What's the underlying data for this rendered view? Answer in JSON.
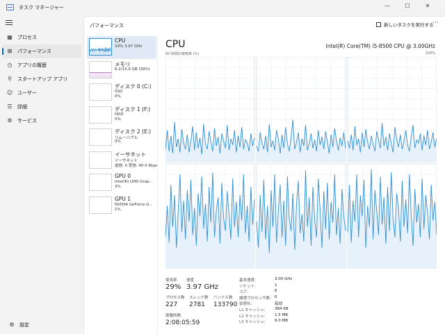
{
  "window": {
    "title": "タスク マネージャー",
    "minimize_glyph": "—",
    "maximize_glyph": "☐",
    "close_glyph": "✕"
  },
  "nav": {
    "items": [
      {
        "label": "プロセス",
        "icon": "grid-icon",
        "glyph": "▦"
      },
      {
        "label": "パフォーマンス",
        "icon": "performance-icon",
        "glyph": "⊠"
      },
      {
        "label": "アプリの履歴",
        "icon": "history-icon",
        "glyph": "◷"
      },
      {
        "label": "スタートアップ アプリ",
        "icon": "startup-icon",
        "glyph": "⚲"
      },
      {
        "label": "ユーザー",
        "icon": "users-icon",
        "glyph": "☺"
      },
      {
        "label": "詳細",
        "icon": "details-icon",
        "glyph": "☰"
      },
      {
        "label": "サービス",
        "icon": "services-icon",
        "glyph": "⚙"
      }
    ],
    "active_index": 1,
    "settings_label": "設定"
  },
  "header": {
    "page_title": "パフォーマンス",
    "run_task_label": "新しいタスクを実行する",
    "more_glyph": "⋯"
  },
  "devices": [
    {
      "name": "CPU",
      "sub1": "29%  3.97 GHz",
      "sub2": "",
      "thumb": "cpu",
      "color": "#2f8fd0"
    },
    {
      "name": "メモリ",
      "sub1": "6.2/15.9 GB (39%)",
      "sub2": "",
      "thumb": "mem",
      "color": "#9b3fa6"
    },
    {
      "name": "ディスク 0 (C:)",
      "sub1": "SSD",
      "sub2": "0%",
      "thumb": "none",
      "color": "#4caf50"
    },
    {
      "name": "ディスク 1 (F:)",
      "sub1": "HDD",
      "sub2": "0%",
      "thumb": "none",
      "color": "#4caf50"
    },
    {
      "name": "ディスク 2 (E:)",
      "sub1": "リムーバブル",
      "sub2": "0%",
      "thumb": "none",
      "color": "#4caf50"
    },
    {
      "name": "イーサネット",
      "sub1": "イーサネット",
      "sub2": "送信: 0 受信: 40.0 Kbps",
      "thumb": "net",
      "color": "#c07020"
    },
    {
      "name": "GPU 0",
      "sub1": "Intel(R) UHD Grap...",
      "sub2": "3%",
      "thumb": "gpu",
      "color": "#2f8fd0"
    },
    {
      "name": "GPU 1",
      "sub1": "NVIDIA GeForce G...",
      "sub2": "1%",
      "thumb": "none",
      "color": "#2f8fd0"
    }
  ],
  "cpu": {
    "title": "CPU",
    "model": "Intel(R) Core(TM) i5-8500 CPU @ 3.00GHz",
    "graph_left_label": "60 秒間の使用率 (%)",
    "graph_right_label": "100%",
    "line_color": "#2f8fd0",
    "fill_color": "#e6f1fb",
    "grid_color": "#e6eef6",
    "chart_data": {
      "type": "line",
      "cores": 6,
      "ylim": [
        0,
        100
      ],
      "series": [
        {
          "values": [
            12,
            30,
            10,
            25,
            8,
            38,
            14,
            22,
            9,
            31,
            18,
            12,
            26,
            9,
            21,
            34,
            11,
            28,
            13,
            23,
            7,
            36,
            17,
            12,
            29,
            19,
            10,
            32,
            15,
            24,
            8,
            27,
            20,
            13,
            35,
            11,
            22,
            16,
            30,
            9,
            25,
            14,
            33,
            12,
            21,
            18,
            10,
            27,
            15,
            23
          ]
        },
        {
          "values": [
            15,
            10,
            28,
            18,
            12,
            25,
            9,
            36,
            14,
            20,
            11,
            30,
            22,
            8,
            26,
            13,
            33,
            17,
            10,
            24,
            40,
            12,
            19,
            28,
            9,
            22,
            15,
            35,
            11,
            18,
            27,
            13,
            21,
            10,
            30,
            16,
            24,
            12,
            29,
            19,
            8,
            26,
            14,
            32,
            20,
            11,
            23,
            15,
            28,
            13
          ]
        },
        {
          "values": [
            20,
            13,
            26,
            11,
            34,
            16,
            22,
            9,
            28,
            14,
            31,
            19,
            12,
            25,
            17,
            10,
            29,
            21,
            13,
            37,
            15,
            24,
            11,
            27,
            18,
            9,
            33,
            22,
            14,
            26,
            12,
            20,
            30,
            16,
            10,
            24,
            35,
            13,
            21,
            18,
            27,
            11,
            25,
            16,
            30,
            12,
            19,
            28,
            14,
            22
          ]
        },
        {
          "values": [
            30,
            60,
            25,
            80,
            40,
            70,
            20,
            55,
            90,
            35,
            65,
            28,
            75,
            45,
            85,
            32,
            58,
            22,
            72,
            50,
            88,
            38,
            62,
            26,
            78,
            44,
            92,
            30,
            56,
            68,
            24,
            82,
            48,
            36,
            74,
            52,
            28,
            86,
            40,
            64,
            30,
            70,
            46,
            90,
            34,
            60,
            26,
            78,
            42,
            66
          ]
        },
        {
          "values": [
            45,
            20,
            70,
            35,
            85,
            28,
            60,
            15,
            75,
            40,
            90,
            25,
            55,
            80,
            30,
            65,
            22,
            88,
            48,
            36,
            72,
            18,
            62,
            84,
            34,
            52,
            26,
            94,
            40,
            68,
            22,
            78,
            46,
            30,
            86,
            56,
            20,
            74,
            38,
            82,
            28,
            64,
            44,
            90,
            32,
            58,
            24,
            76,
            50,
            36
          ]
        },
        {
          "values": [
            35,
            80,
            25,
            65,
            45,
            90,
            30,
            70,
            50,
            85,
            20,
            60,
            40,
            95,
            28,
            75,
            55,
            32,
            88,
            42,
            68,
            24,
            78,
            36,
            92,
            48,
            30,
            72,
            58,
            26,
            84,
            40,
            66,
            34,
            90,
            52,
            22,
            76,
            44,
            62,
            30,
            86,
            38,
            70,
            54,
            28,
            80,
            46,
            64,
            32
          ]
        }
      ]
    }
  },
  "stats": {
    "util_label": "使用率",
    "util_value": "29%",
    "speed_label": "速度",
    "speed_value": "3.97 GHz",
    "process_label": "プロセス数",
    "process_value": "227",
    "thread_label": "スレッド数",
    "thread_value": "2781",
    "handle_label": "ハンドル数",
    "handle_value": "133790",
    "uptime_label": "稼働時間",
    "uptime_value": "2:08:05:59",
    "kv": [
      {
        "key": "基本速度:",
        "value": "3.00 GHz"
      },
      {
        "key": "ソケット:",
        "value": "1"
      },
      {
        "key": "コア:",
        "value": "6"
      },
      {
        "key": "論理プロセッサ数:",
        "value": "6"
      },
      {
        "key": "仮想化:",
        "value": "有効"
      },
      {
        "key": "L1 キャッシュ:",
        "value": "384 KB"
      },
      {
        "key": "L2 キャッシュ:",
        "value": "1.5 MB"
      },
      {
        "key": "L3 キャッシュ:",
        "value": "9.0 MB"
      }
    ]
  }
}
